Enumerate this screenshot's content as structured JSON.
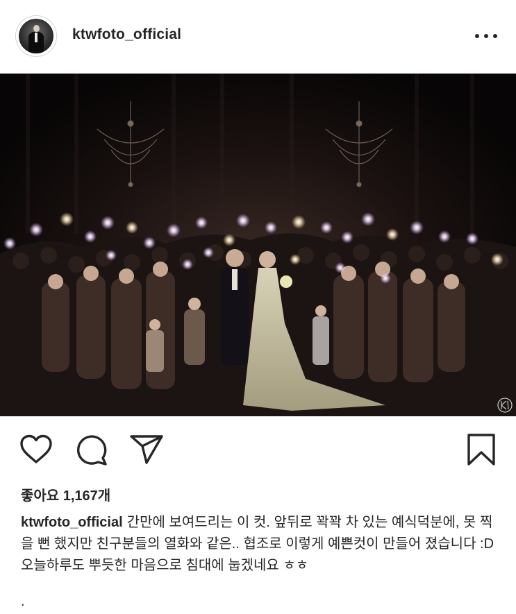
{
  "post": {
    "username": "ktwfoto_official",
    "likes_text": "좋아요 1,167개",
    "caption_user": "ktwfoto_official",
    "caption_text": "간만에 보여드리는 이 컷. 앞뒤로 꽉꽉 차 있는 예식덕분에, 못 찍을 뻔 했지만 친구분들의 열화와 같은.. 협조로 이렇게 예쁜컷이 만들어 졌습니다 :D 오늘하루도 뿌듯한 마음으로 침대에 눕겠네요 ㅎㅎ",
    "trailing": "."
  },
  "icons": {
    "more": "more-options-icon",
    "like": "heart-icon",
    "comment": "comment-icon",
    "share": "send-icon",
    "save": "bookmark-icon"
  },
  "colors": {
    "text": "#262626",
    "photo_background": "#0a0708",
    "dress": "#c9c3a8"
  }
}
